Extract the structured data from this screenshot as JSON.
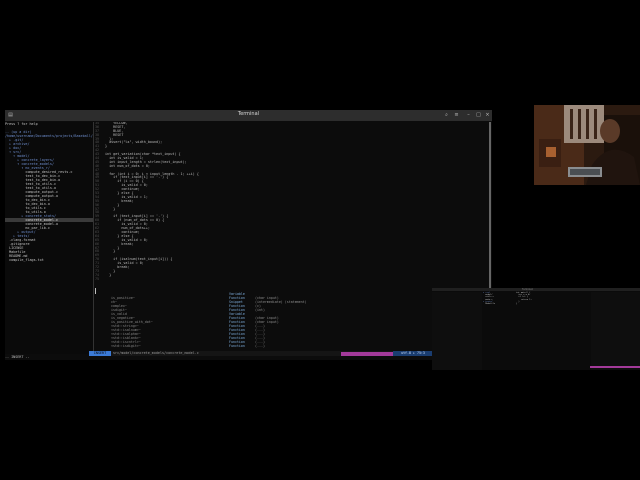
{
  "window": {
    "title": "Terminal"
  },
  "tree": {
    "items": [
      {
        "text": "Press ? for help",
        "kind": "file"
      },
      {
        "text": "",
        "kind": "file"
      },
      {
        "text": ".. (up a dir)",
        "kind": "dir"
      },
      {
        "text": "/home/username/Documents/projects/Baseball/",
        "kind": "dir"
      },
      {
        "text": "  ▸ .git/",
        "kind": "dir"
      },
      {
        "text": "  ▸ archive/",
        "kind": "dir"
      },
      {
        "text": "  ▸ doc/",
        "kind": "dir"
      },
      {
        "text": "  ▾ src/",
        "kind": "dir"
      },
      {
        "text": "    ▾ model/",
        "kind": "dir"
      },
      {
        "text": "      ▸ concrete_layers/",
        "kind": "dir"
      },
      {
        "text": "      ▾ concrete_models/",
        "kind": "dir"
      },
      {
        "text": "        ▾ mc_events_r/",
        "kind": "dir"
      },
      {
        "text": "          compute_desired_rests.c",
        "kind": "file"
      },
      {
        "text": "          test_to_dec_bin.c",
        "kind": "file"
      },
      {
        "text": "          test_to_dec_bin.o",
        "kind": "file"
      },
      {
        "text": "          test_to_utils.c",
        "kind": "file"
      },
      {
        "text": "          test_to_utils.o",
        "kind": "file"
      },
      {
        "text": "          compute_output.c",
        "kind": "file"
      },
      {
        "text": "          compute_output.o",
        "kind": "file"
      },
      {
        "text": "          to_dec_bin.c",
        "kind": "file"
      },
      {
        "text": "          to_dec_bin.o",
        "kind": "file"
      },
      {
        "text": "          to_utils.c",
        "kind": "file"
      },
      {
        "text": "          to_utils.o",
        "kind": "file"
      },
      {
        "text": "        ▸ concrete_stats/",
        "kind": "dir"
      },
      {
        "text": "          concrete_model.c",
        "kind": "sel"
      },
      {
        "text": "          concrete_model.o",
        "kind": "file"
      },
      {
        "text": "          mc_par_lib.c",
        "kind": "file"
      },
      {
        "text": "      ▸ output/",
        "kind": "dir"
      },
      {
        "text": "    ▸ tests/",
        "kind": "dir"
      },
      {
        "text": "  .clang-format",
        "kind": "file"
      },
      {
        "text": "  .gitignore",
        "kind": "file"
      },
      {
        "text": "  LICENSE",
        "kind": "file"
      },
      {
        "text": "  Makefile",
        "kind": "file"
      },
      {
        "text": "  README.md",
        "kind": "file"
      },
      {
        "text": "  compile_flags.txt",
        "kind": "file"
      }
    ]
  },
  "editor": {
    "lines": [
      {
        "no": "35",
        "code": "    YELLOW,"
      },
      {
        "no": "36",
        "code": "    RESET,"
      },
      {
        "no": "37",
        "code": "    BLUE,"
      },
      {
        "no": "38",
        "code": "    RESET"
      },
      {
        "no": "39",
        "code": "  };"
      },
      {
        "no": "40",
        "code": "  assert(\"%s\", width_bound);"
      },
      {
        "no": "41",
        "code": "}"
      },
      {
        "no": "42",
        "code": ""
      },
      {
        "no": "43",
        "code": "int get_variation(char *text_input) {"
      },
      {
        "no": "44",
        "code": "  int is_valid = 1;"
      },
      {
        "no": "45",
        "code": "  int input_length = strlen(text_input);"
      },
      {
        "no": "46",
        "code": "  int num_of_dots = 0;"
      },
      {
        "no": "47",
        "code": ""
      },
      {
        "no": "48",
        "code": "  for (int i = 0; i < input_length - 1; ++i) {"
      },
      {
        "no": "49",
        "code": "    if (text_input[i] == '.') {"
      },
      {
        "no": "50",
        "code": "      if (i == 0) {"
      },
      {
        "no": "51",
        "code": "        is_valid = 0;"
      },
      {
        "no": "52",
        "code": "        continue;"
      },
      {
        "no": "53",
        "code": "      } else {"
      },
      {
        "no": "54",
        "code": "        is_valid = 1;"
      },
      {
        "no": "55",
        "code": "        break;"
      },
      {
        "no": "56",
        "code": "      }"
      },
      {
        "no": "57",
        "code": "    }"
      },
      {
        "no": "58",
        "code": ""
      },
      {
        "no": "59",
        "code": "    if (text_input[i] == '.') {"
      },
      {
        "no": "60",
        "code": "      if (num_of_dots == 0) {"
      },
      {
        "no": "61",
        "code": "        is_valid = 0;"
      },
      {
        "no": "62",
        "code": "        num_of_dots++;"
      },
      {
        "no": "63",
        "code": "        continue;"
      },
      {
        "no": "64",
        "code": "      } else {"
      },
      {
        "no": "65",
        "code": "        is_valid = 0;"
      },
      {
        "no": "66",
        "code": "        break;"
      },
      {
        "no": "67",
        "code": "      }"
      },
      {
        "no": "68",
        "code": "    }"
      },
      {
        "no": "69",
        "code": ""
      },
      {
        "no": "70",
        "code": "    if (isalnum(text_input[i])) {"
      },
      {
        "no": "71",
        "code": "      is_valid = 0;"
      },
      {
        "no": "72",
        "code": "      break;"
      },
      {
        "no": "73",
        "code": "    }"
      },
      {
        "no": "74",
        "code": "  }"
      },
      {
        "no": "75",
        "code": ""
      }
    ]
  },
  "completion": {
    "items": [
      {
        "key": "",
        "name": "",
        "type": "Variable",
        "desc": ""
      },
      {
        "key": "is_positive~",
        "name": "",
        "type": "Function",
        "desc": "(char input)"
      },
      {
        "key": "ch~",
        "name": "",
        "type": "Snippet",
        "desc": "(intermediate) (statement)"
      },
      {
        "key": "complex~",
        "name": "",
        "type": "Function",
        "desc": "(c)"
      },
      {
        "key": "isdigit~",
        "name": "",
        "type": "Function",
        "desc": "(int)"
      },
      {
        "key": "is_valid",
        "name": "",
        "type": "Variable",
        "desc": ""
      },
      {
        "key": "is_negative~",
        "name": "",
        "type": "Function",
        "desc": "(char input)"
      },
      {
        "key": "is_positive_with_dot~",
        "name": "",
        "type": "Function",
        "desc": "(char input)"
      },
      {
        "key": "<std::string>~",
        "name": "",
        "type": "Function",
        "desc": "(...)"
      },
      {
        "key": "<std::isalnum>~",
        "name": "",
        "type": "Function",
        "desc": "(...)"
      },
      {
        "key": "<std::isalpha>~",
        "name": "",
        "type": "Function",
        "desc": "(...)"
      },
      {
        "key": "<std::isblank>~",
        "name": "",
        "type": "Function",
        "desc": "(...)"
      },
      {
        "key": "<std::iscntrl>~",
        "name": "",
        "type": "Function",
        "desc": "(...)"
      },
      {
        "key": "<std::isdigit>~",
        "name": "",
        "type": "Function",
        "desc": "(...)"
      }
    ]
  },
  "status": {
    "mode": "INSERT",
    "info": "src/model/concrete_models/concrete_model.c",
    "right": "utf-8 ▸ 75:3",
    "cmdline": "-- INSERT --"
  },
  "thumb": {
    "title": "Terminal"
  }
}
